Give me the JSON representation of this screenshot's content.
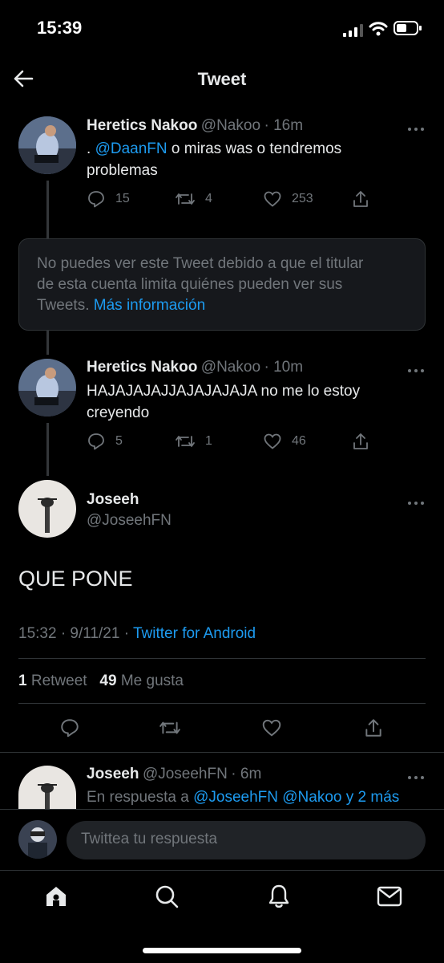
{
  "status_bar": {
    "time": "15:39"
  },
  "header": {
    "title": "Tweet"
  },
  "tweets": [
    {
      "name": "Heretics Nakoo",
      "handle": "@Nakoo",
      "time": "· 16m",
      "text_prefix": ".",
      "mention": "@DaanFN",
      "text_rest": "o miras was o tendremos",
      "text_line2": "problemas",
      "replies": "15",
      "retweets": "4",
      "likes": "253"
    },
    {
      "name": "Heretics Nakoo",
      "handle": "@Nakoo",
      "time": "· 10m",
      "text_line1": "HAJAJAJAJJAJAJAJAJA no me lo estoy",
      "text_line2": "creyendo",
      "replies": "5",
      "retweets": "1",
      "likes": "46"
    }
  ],
  "notice": {
    "line1": "No puedes ver este Tweet debido a que el titular",
    "line2": "de esta cuenta limita quiénes pueden ver sus",
    "line3_prefix": "Tweets.",
    "more_info": "Más información"
  },
  "main_tweet": {
    "name": "Joseeh",
    "handle": "@JoseehFN",
    "text": "QUE PONE",
    "timestamp": "15:32 · 9/11/21 ·",
    "source": "Twitter for Android",
    "retweet_count": "1",
    "retweet_label": "Retweet",
    "like_count": "49",
    "like_label": "Me gusta"
  },
  "reply_tweet": {
    "name": "Joseeh",
    "handle": "@JoseehFN",
    "time": "· 6m",
    "reply_prefix": "En respuesta a",
    "reply_mentions": "@JoseehFN @Nakoo y 2 más"
  },
  "reply_bar": {
    "placeholder": "Twittea tu respuesta"
  },
  "tab_bar": {
    "icons": [
      "home-icon",
      "search-icon",
      "notifications-icon",
      "messages-icon"
    ]
  }
}
